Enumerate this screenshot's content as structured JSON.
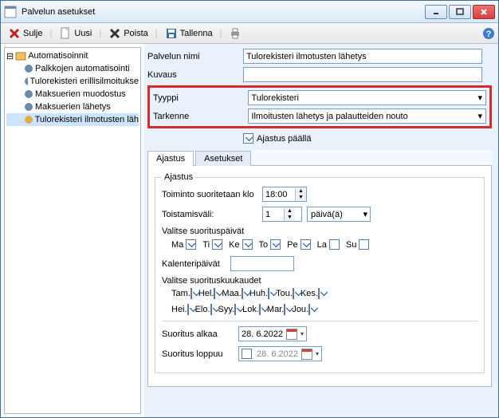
{
  "window": {
    "title": "Palvelun asetukset"
  },
  "toolbar": {
    "close": "Sulje",
    "new": "Uusi",
    "delete": "Poista",
    "save": "Tallenna"
  },
  "tree": {
    "root": "Automatisoinnit",
    "items": [
      "Palkkojen automatisointi",
      "Tulorekisteri erillisilmoitukse",
      "Maksuerien muodostus",
      "Maksuerien lähetys",
      "Tulorekisteri ilmotusten läh"
    ]
  },
  "form": {
    "name_label": "Palvelun nimi",
    "name_value": "Tulorekisteri ilmotusten lähetys",
    "desc_label": "Kuvaus",
    "desc_value": "",
    "type_label": "Tyyppi",
    "type_value": "Tulorekisteri",
    "target_label": "Tarkenne",
    "target_value": "Ilmoitusten lähetys ja palautteiden nouto",
    "scheduled_label": "Ajastus päällä"
  },
  "tabs": {
    "t1": "Ajastus",
    "t2": "Asetukset"
  },
  "schedule": {
    "legend": "Ajastus",
    "run_at_label": "Toiminto suoritetaan klo",
    "run_at_value": "18:00",
    "interval_label": "Toistamisväli:",
    "interval_value": "1",
    "interval_unit": "päivä(ä)",
    "days_label": "Valitse suorituspäivät",
    "days": [
      {
        "k": "Ma",
        "c": true
      },
      {
        "k": "Ti",
        "c": true
      },
      {
        "k": "Ke",
        "c": true
      },
      {
        "k": "To",
        "c": true
      },
      {
        "k": "Pe",
        "c": true
      },
      {
        "k": "La",
        "c": false
      },
      {
        "k": "Su",
        "c": false
      }
    ],
    "caldays_label": "Kalenteripäivät",
    "months_label": "Valitse suorituskuukaudet",
    "months_row1": [
      {
        "k": "Tam.",
        "c": true
      },
      {
        "k": "Hel.",
        "c": true
      },
      {
        "k": "Maa.",
        "c": true
      },
      {
        "k": "Huh.",
        "c": true
      },
      {
        "k": "Tou.",
        "c": true
      },
      {
        "k": "Kes.",
        "c": true
      }
    ],
    "months_row2": [
      {
        "k": "Hei.",
        "c": true
      },
      {
        "k": "Elo.",
        "c": true
      },
      {
        "k": "Syy.",
        "c": true
      },
      {
        "k": "Lok.",
        "c": true
      },
      {
        "k": "Mar.",
        "c": true
      },
      {
        "k": "Jou.",
        "c": true
      }
    ],
    "start_label": "Suoritus alkaa",
    "start_value": "28.  6.2022",
    "end_label": "Suoritus loppuu",
    "end_value": "28.  6.2022"
  }
}
